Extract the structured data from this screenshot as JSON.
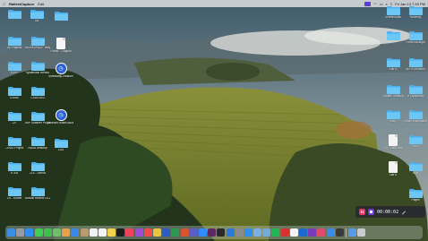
{
  "menubar": {
    "app_name": "RallestCapture",
    "menu_edit": "Edit",
    "clock": "Fri Jan 13 7:39 PM",
    "accent": "#5b3fd1"
  },
  "desktop": {
    "left_icons": [
      {
        "label": "",
        "kind": "folder"
      },
      {
        "label": "Git",
        "kind": "folder"
      },
      {
        "label": "",
        "kind": "folder"
      },
      {
        "label": "Dy Projects",
        "kind": "folder"
      },
      {
        "label": "WORKSPACE Templates",
        "kind": "folder"
      },
      {
        "label": "Poster - Original",
        "kind": "doc"
      },
      {
        "label": "ESPP",
        "kind": "folder"
      },
      {
        "label": "Systematic Review",
        "kind": "folder"
      },
      {
        "label": "timestamp-creation",
        "kind": "clock"
      },
      {
        "label": "iCloud",
        "kind": "folder"
      },
      {
        "label": "CSUS-803",
        "kind": "folder"
      },
      {
        "label": "CV",
        "kind": "folder"
      },
      {
        "label": "WIP Summer Project",
        "kind": "folder"
      },
      {
        "label": "timeline-model.docx",
        "kind": "clock"
      },
      {
        "label": "COVID Project",
        "kind": "folder"
      },
      {
        "label": "NASA Desktop",
        "kind": "folder"
      },
      {
        "label": "CSS",
        "kind": "folder"
      },
      {
        "label": "R 303",
        "kind": "folder"
      },
      {
        "label": "CLS - School",
        "kind": "folder"
      },
      {
        "label": "Ch - Yousef",
        "kind": "folder"
      },
      {
        "label": "Annual Review 23-24",
        "kind": "folder"
      }
    ],
    "right_icons": [
      {
        "label": "Screenshots",
        "kind": "folder"
      },
      {
        "label": "Recently",
        "kind": "folder"
      },
      {
        "label": "",
        "kind": "folder"
      },
      {
        "label": "Fonts Backups",
        "kind": "folder"
      },
      {
        "label": "Lab 4",
        "kind": "folder"
      },
      {
        "label": "WSTN Infusion",
        "kind": "folder"
      },
      {
        "label": "System Desktop",
        "kind": "folder"
      },
      {
        "label": "R Diplomacy",
        "kind": "folder"
      },
      {
        "label": "EBS",
        "kind": "folder"
      },
      {
        "label": "Policy Workspace",
        "kind": "folder"
      },
      {
        "label": "CV - Lab4.doc",
        "kind": "doc"
      },
      {
        "label": "SSS",
        "kind": "folder"
      },
      {
        "label": "Lab 5",
        "kind": "doc"
      },
      {
        "label": "BBM",
        "kind": "folder"
      },
      {
        "label": "Pages",
        "kind": "folder"
      }
    ]
  },
  "recorder": {
    "time": "00:00:02",
    "pause_color": "#e23b66",
    "stop_color": "#6a3fd8"
  },
  "dock": {
    "apps": [
      {
        "name": "finder-icon",
        "color": "#3b8ee8"
      },
      {
        "name": "launchpad-icon",
        "color": "#9a9aa2"
      },
      {
        "name": "safari-icon",
        "color": "#2f8ff0"
      },
      {
        "name": "messages-icon",
        "color": "#3fcf55"
      },
      {
        "name": "facetime-icon",
        "color": "#3fbf4f"
      },
      {
        "name": "maps-icon",
        "color": "#6fbf6a"
      },
      {
        "name": "photos-icon",
        "color": "#e8a04a"
      },
      {
        "name": "mail-icon",
        "color": "#3b86e8"
      },
      {
        "name": "contacts-icon",
        "color": "#b89a70"
      },
      {
        "name": "calendar-icon",
        "color": "#f2f2f2"
      },
      {
        "name": "reminders-icon",
        "color": "#f4f4f4"
      },
      {
        "name": "notes-icon",
        "color": "#f3d34a"
      },
      {
        "name": "tv-icon",
        "color": "#1c1c1c"
      },
      {
        "name": "music-icon",
        "color": "#f0435a"
      },
      {
        "name": "podcasts-icon",
        "color": "#a24ad8"
      },
      {
        "name": "news-icon",
        "color": "#f04a4a"
      },
      {
        "name": "chrome-icon",
        "color": "#e8c440"
      },
      {
        "name": "word-icon",
        "color": "#2b5cc8"
      },
      {
        "name": "excel-icon",
        "color": "#2a9a4e"
      },
      {
        "name": "powerpoint-icon",
        "color": "#d8532e"
      },
      {
        "name": "teams-icon",
        "color": "#5a5fc8"
      },
      {
        "name": "zoom-icon",
        "color": "#2d8cff"
      },
      {
        "name": "slack-icon",
        "color": "#5a2a60"
      },
      {
        "name": "terminal-icon",
        "color": "#2a2a2a"
      },
      {
        "name": "vscode-icon",
        "color": "#2a7ad8"
      },
      {
        "name": "system-settings-icon",
        "color": "#8a8a90"
      },
      {
        "name": "app-store-icon",
        "color": "#2f8ff0"
      },
      {
        "name": "preview-icon",
        "color": "#7ab0e8"
      },
      {
        "name": "rstudio-icon",
        "color": "#75a9d8"
      },
      {
        "name": "spotify-icon",
        "color": "#1db954"
      },
      {
        "name": "acrobat-icon",
        "color": "#d8322e"
      },
      {
        "name": "notion-icon",
        "color": "#f4f4f4"
      },
      {
        "name": "outlook-icon",
        "color": "#1a6ad0"
      },
      {
        "name": "onenote-icon",
        "color": "#7a3ab8"
      },
      {
        "name": "capture-icon",
        "color": "#e04a6a"
      },
      {
        "name": "xcode-icon",
        "color": "#3a8ae8"
      },
      {
        "name": "activity-icon",
        "color": "#3a3a3a"
      },
      {
        "name": "downloads-icon",
        "color": "#5a9ae8"
      },
      {
        "name": "trash-icon",
        "color": "#c8ccd2"
      }
    ]
  }
}
